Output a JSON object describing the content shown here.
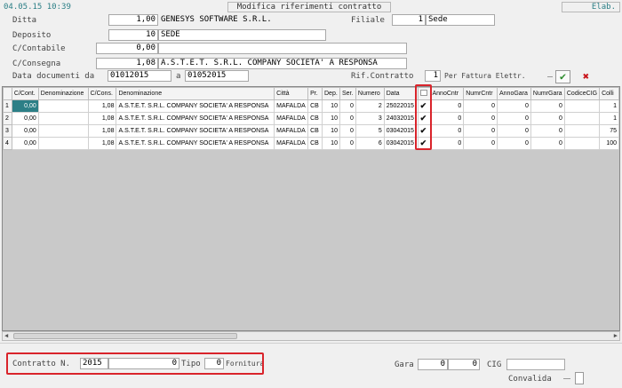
{
  "header": {
    "datetime": "04.05.15 10:39",
    "title": "Modifica riferimenti contratto",
    "elab_label": "Elab."
  },
  "form": {
    "ditta_label": "Ditta",
    "ditta_code": "1,00",
    "ditta_name": "GENESYS SOFTWARE S.R.L.",
    "filiale_label": "Filiale",
    "filiale_code": "1",
    "filiale_name": "Sede",
    "deposito_label": "Deposito",
    "deposito_code": "10",
    "deposito_name": "SEDE",
    "ccontabile_label": "C/Contabile",
    "ccontabile_code": "0,00",
    "ccontabile_name": "",
    "cconsegna_label": "C/Consegna",
    "cconsegna_code": "1,08",
    "cconsegna_name": "A.S.T.E.T. S.R.L. COMPANY SOCIETA' A RESPONSA",
    "data_doc_label": "Data documenti da",
    "data_da": "01012015",
    "a_label": "a",
    "data_a": "01052015",
    "rif_contratto_label": "Rif.Contratto",
    "rif_contratto_value": "1",
    "per_fattura_label": "Per Fattura Elettr."
  },
  "grid": {
    "columns": [
      "C/Cont.",
      "Denominazione",
      "C/Cons.",
      "Denominazione",
      "Città",
      "Pr.",
      "Dep.",
      "Ser.",
      "Numero",
      "Data",
      "",
      "AnnoCntr",
      "NumrCntr",
      "AnnoGara",
      "NumrGara",
      "CodiceCIG",
      "Colli"
    ],
    "rows": [
      {
        "n": "1",
        "ccont": "0,00",
        "den1": "",
        "ccons": "1,08",
        "den2": "A.S.T.E.T. S.R.L. COMPANY SOCIETA' A RESPONSA",
        "citta": "MAFALDA",
        "pr": "CB",
        "dep": "10",
        "ser": "0",
        "numero": "2",
        "data": "25022015",
        "anno_cntr": "0",
        "numr_cntr": "0",
        "anno_gara": "0",
        "numr_gara": "0",
        "cig": "",
        "colli": "1"
      },
      {
        "n": "2",
        "ccont": "0,00",
        "den1": "",
        "ccons": "1,08",
        "den2": "A.S.T.E.T. S.R.L. COMPANY SOCIETA' A RESPONSA",
        "citta": "MAFALDA",
        "pr": "CB",
        "dep": "10",
        "ser": "0",
        "numero": "3",
        "data": "24032015",
        "anno_cntr": "0",
        "numr_cntr": "0",
        "anno_gara": "0",
        "numr_gara": "0",
        "cig": "",
        "colli": "1"
      },
      {
        "n": "3",
        "ccont": "0,00",
        "den1": "",
        "ccons": "1,08",
        "den2": "A.S.T.E.T. S.R.L. COMPANY SOCIETA' A RESPONSA",
        "citta": "MAFALDA",
        "pr": "CB",
        "dep": "10",
        "ser": "0",
        "numero": "5",
        "data": "03042015",
        "anno_cntr": "0",
        "numr_cntr": "0",
        "anno_gara": "0",
        "numr_gara": "0",
        "cig": "",
        "colli": "75"
      },
      {
        "n": "4",
        "ccont": "0,00",
        "den1": "",
        "ccons": "1,08",
        "den2": "A.S.T.E.T. S.R.L. COMPANY SOCIETA' A RESPONSA",
        "citta": "MAFALDA",
        "pr": "CB",
        "dep": "10",
        "ser": "0",
        "numero": "6",
        "data": "03042015",
        "anno_cntr": "0",
        "numr_cntr": "0",
        "anno_gara": "0",
        "numr_gara": "0",
        "cig": "",
        "colli": "100"
      }
    ]
  },
  "bottom": {
    "contratto_label": "Contratto N.",
    "contratto_year": "2015",
    "contratto_num": "0",
    "tipo_label": "Tipo",
    "tipo_value": "0",
    "fornitura_label": "Fornitura",
    "gara_label": "Gara",
    "gara_year": "0",
    "gara_num": "0",
    "cig_label": "CIG",
    "cig_value": "",
    "convalida_label": "Convalida"
  },
  "colors": {
    "accent_teal": "#2c7f86",
    "highlight_red": "#d9242b",
    "ok_green": "#2d8c2d",
    "cancel_red": "#c8141b"
  }
}
